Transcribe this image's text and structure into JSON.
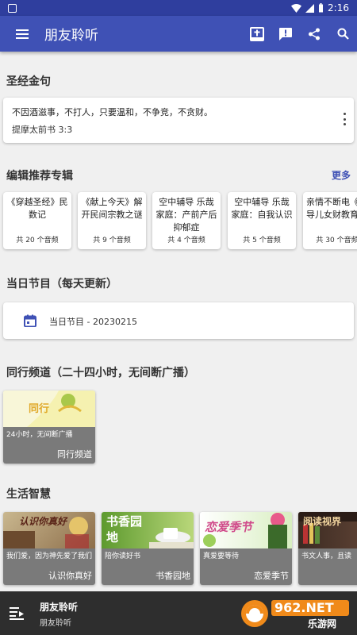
{
  "status": {
    "time": "2:16"
  },
  "appbar": {
    "title": "朋友聆听"
  },
  "verse": {
    "section_title": "圣经金句",
    "text": "不因酒滋事，不打人，只要温和，不争竞，不贪财。",
    "reference": "提摩太前书 3:3"
  },
  "albums": {
    "section_title": "编辑推荐专辑",
    "more_label": "更多",
    "items": [
      {
        "title": "《穿越圣经》民数记",
        "count": "共 20 个音频"
      },
      {
        "title": "《献上今天》解开民间宗教之谜",
        "count": "共 9 个音频"
      },
      {
        "title": "空中辅导 乐哉家庭：产前产后抑郁症",
        "count": "共 4 个音频"
      },
      {
        "title": "空中辅导 乐哉家庭：自我认识",
        "count": "共 5 个音频"
      },
      {
        "title": "亲情不断电《教导儿女财教育》",
        "count": "共 30 个音频"
      }
    ]
  },
  "today": {
    "section_title": "当日节目（每天更新）",
    "label": "当日节目 - 20230215"
  },
  "channel": {
    "section_title": "同行频道（二十四小时，无间断广播）",
    "image_text": "同行",
    "desc": "24小时，无间断广播",
    "name": "同行频道"
  },
  "life": {
    "section_title": "生活智慧",
    "items": [
      {
        "image_text": "认识你真好",
        "desc": "我们爱，因为神先爱了我们",
        "name": "认识你真好"
      },
      {
        "image_text": "书香园地",
        "desc": "陪你读好书",
        "name": "书香园地"
      },
      {
        "image_text": "恋爱季节",
        "desc": "真爱要等待",
        "name": "恋爱季节"
      },
      {
        "image_text": "阅读视界",
        "desc": "书文人事，且读",
        "name": "阅"
      }
    ]
  },
  "player": {
    "title": "朋友聆听",
    "subtitle": "朋友聆听"
  },
  "watermark": {
    "text": "962.NET",
    "sub": "乐游网"
  },
  "colors": {
    "primary": "#3f51b5",
    "status": "#2f3e9e",
    "background": "#f0f0f0",
    "link": "#3f51b5"
  }
}
